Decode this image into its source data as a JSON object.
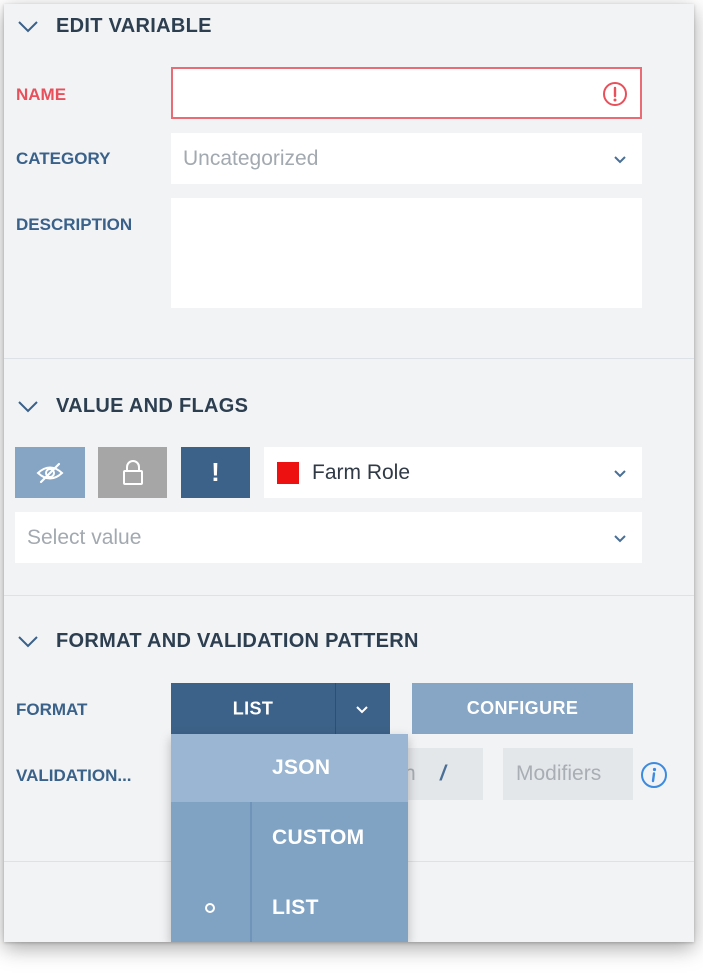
{
  "edit_variable": {
    "title": "EDIT VARIABLE",
    "name_label": "NAME",
    "name_value": "",
    "category_label": "CATEGORY",
    "category_value": "Uncategorized",
    "description_label": "DESCRIPTION",
    "description_value": ""
  },
  "value_and_flags": {
    "title": "VALUE AND FLAGS",
    "required_flag_label": "!",
    "scope_label": "Farm Role",
    "scope_color": "#ee1111",
    "value_placeholder": "Select value"
  },
  "format_validation": {
    "title": "FORMAT AND VALIDATION PATTERN",
    "format_label": "FORMAT",
    "format_selected": "LIST",
    "configure_label": "CONFIGURE",
    "validation_label": "VALIDATION...",
    "pattern_partial": "n",
    "pattern_separator": "/",
    "modifiers_placeholder": "Modifiers",
    "format_options": [
      "JSON",
      "CUSTOM",
      "LIST"
    ]
  },
  "colors": {
    "accent_dark": "#3d6289",
    "accent_light": "#87a5c5",
    "error": "#e8505b",
    "info": "#3d8be0"
  }
}
